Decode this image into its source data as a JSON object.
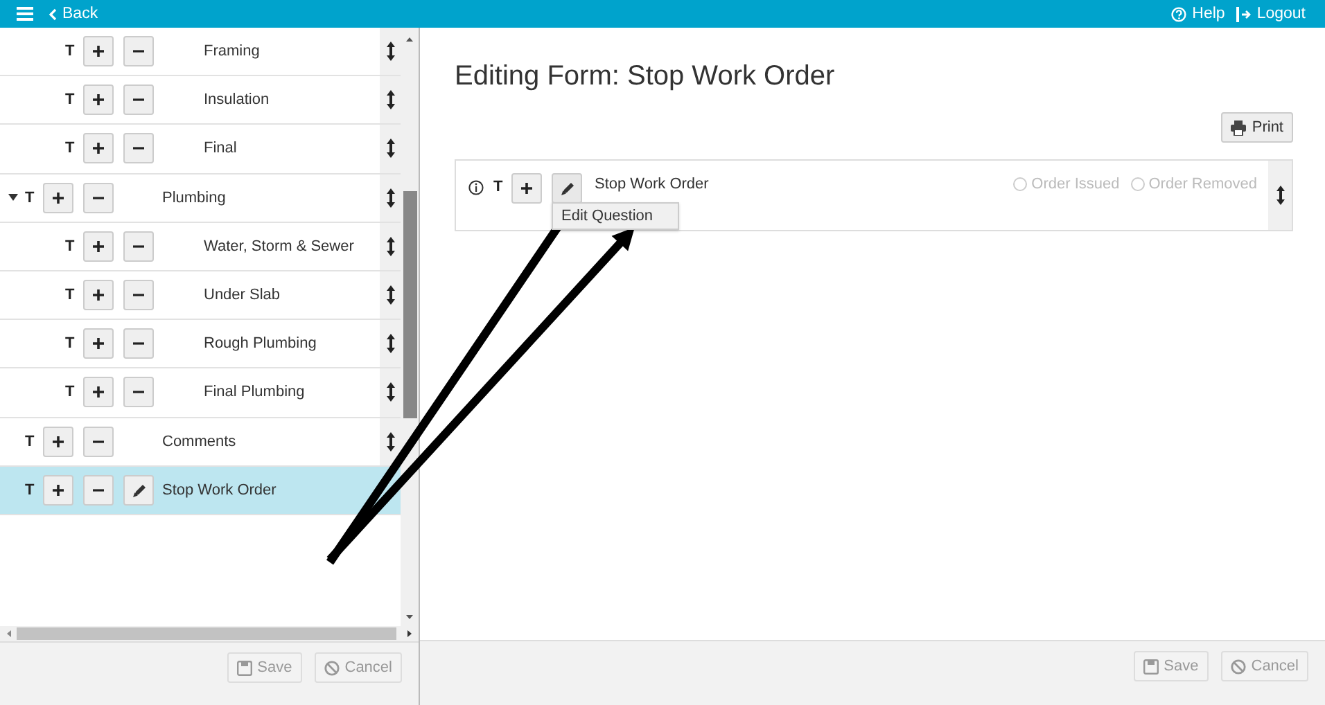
{
  "header": {
    "back": "Back",
    "help": "Help",
    "logout": "Logout"
  },
  "tree": [
    {
      "children": [
        {
          "type": "T",
          "label": "Framing",
          "selected": false
        },
        {
          "type": "T",
          "label": "Insulation",
          "selected": false
        },
        {
          "type": "T",
          "label": "Final",
          "selected": false
        }
      ]
    },
    {
      "type": "T",
      "label": "Plumbing",
      "selected": false,
      "expanded": true,
      "children": [
        {
          "type": "T",
          "label": "Water, Storm & Sewer",
          "selected": false
        },
        {
          "type": "T",
          "label": "Under Slab",
          "selected": false
        },
        {
          "type": "T",
          "label": "Rough Plumbing",
          "selected": false
        },
        {
          "type": "T",
          "label": "Final Plumbing",
          "selected": false
        }
      ]
    },
    {
      "type": "T",
      "label": "Comments",
      "selected": false
    },
    {
      "type": "T",
      "label": "Stop Work Order",
      "selected": true
    }
  ],
  "left_footer": {
    "buttons": [
      {
        "kind": "save",
        "label": "Save",
        "disabled": true
      },
      {
        "kind": "cancel",
        "label": "Cancel",
        "disabled": true
      }
    ]
  },
  "editor": {
    "title": "Editing Form: Stop Work Order",
    "print": "Print",
    "question": {
      "type": "T",
      "label": "Stop Work Order",
      "tooltip": "Edit Question",
      "options": [
        {
          "label": "Order Issued",
          "selected": false
        },
        {
          "label": "Order Removed",
          "selected": false
        }
      ]
    }
  },
  "right_footer": {
    "buttons": [
      {
        "kind": "save",
        "label": "Save",
        "disabled": true
      },
      {
        "kind": "cancel",
        "label": "Cancel",
        "disabled": true
      }
    ]
  }
}
